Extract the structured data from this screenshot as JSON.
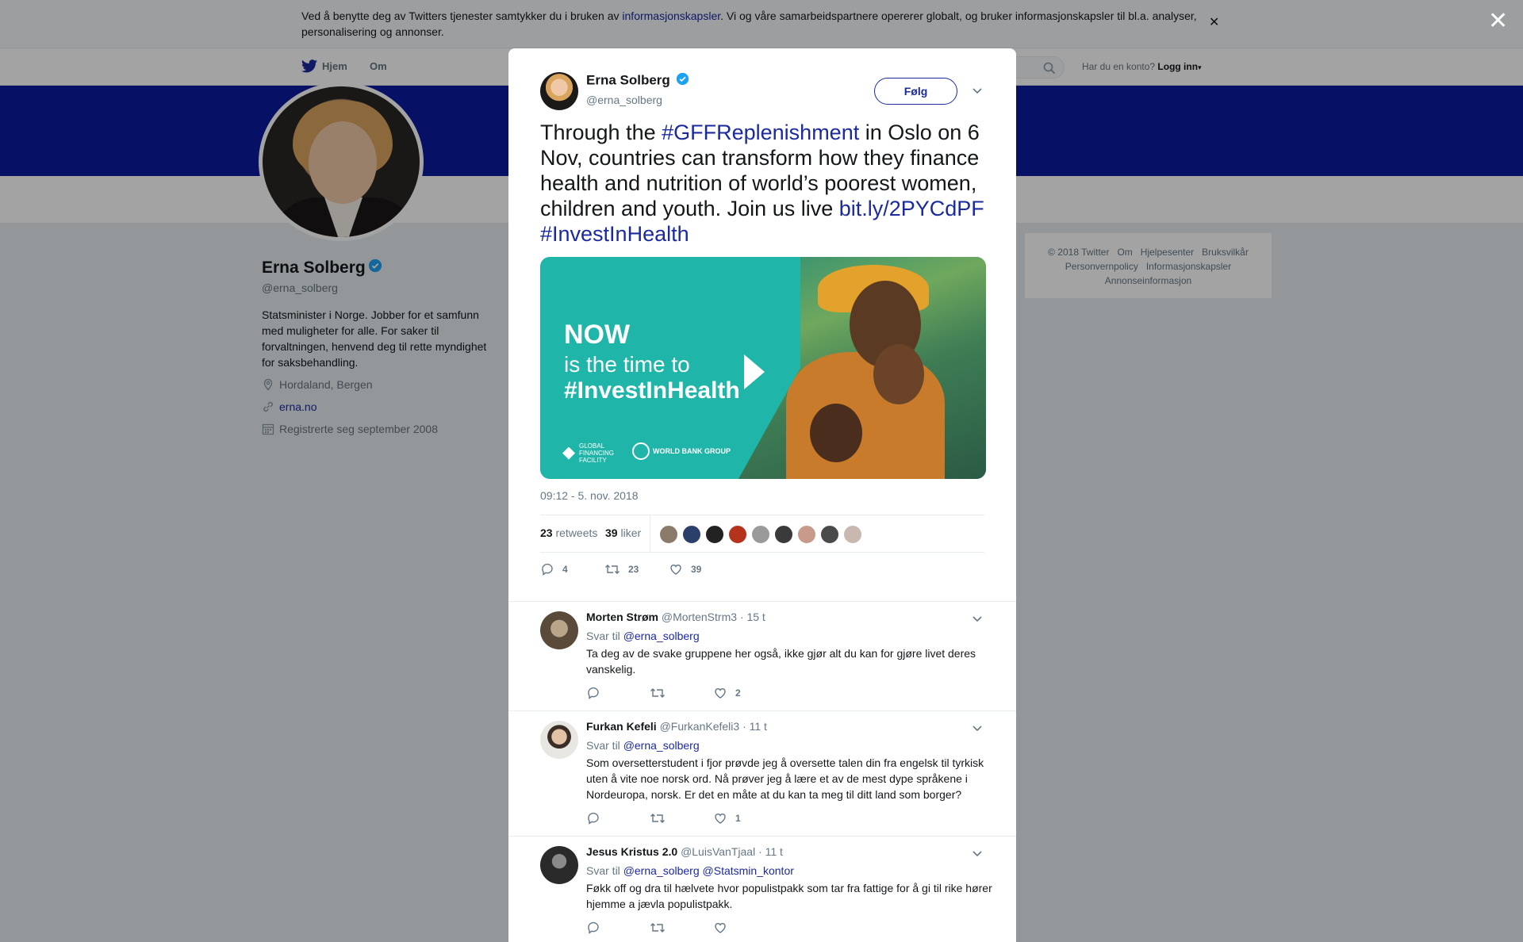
{
  "cookie": {
    "text_before": "Ved å benytte deg av Twitters tjenester samtykker du i bruken av ",
    "link": "informasjonskapsler",
    "text_after": ". Vi og våre samarbeidspartnere opererer globalt, og bruker informasjonskapsler til bl.a. analyser, personalisering og annonser."
  },
  "nav": {
    "home": "Hjem",
    "about": "Om",
    "account_prompt": "Har du en konto?",
    "login": "Logg inn"
  },
  "profile": {
    "name": "Erna Solberg",
    "handle": "@erna_solberg",
    "bio": "Statsminister i Norge. Jobber for et samfunn med muligheter for alle. For saker til forvaltningen, henvend deg til rette myndighet for saksbehandling.",
    "location": "Hordaland, Bergen",
    "website": "erna.no",
    "joined": "Registrerte seg september 2008"
  },
  "footer": {
    "copyright": "© 2018 Twitter",
    "about": "Om",
    "help": "Hjelpesenter",
    "terms": "Bruksvilkår",
    "privacy": "Personvernpolicy",
    "cookies": "Informasjonskapsler",
    "ads": "Annonseinformasjon"
  },
  "tweet": {
    "author_name": "Erna Solberg",
    "author_handle": "@erna_solberg",
    "follow_label": "Følg",
    "text_1": "Through the ",
    "hashtag_1": "#GFFReplenishment",
    "text_2": " in Oslo on 6 Nov, countries can transform how they finance health and nutrition of world’s poorest women, children and youth. Join us live ",
    "link": "bit.ly/2PYCdPF",
    "hashtag_2": "#InvestInHealth",
    "media": {
      "line_1": "NOW",
      "line_2": "is the time to",
      "line_3": "#InvestInHealth",
      "logo_1": "GLOBAL FINANCING FACILITY",
      "logo_2": "WORLD BANK GROUP"
    },
    "timestamp": "09:12 - 5. nov. 2018",
    "retweets": "23",
    "retweets_label": "retweets",
    "likes": "39",
    "likes_label": "liker",
    "reply_count": "4",
    "retweet_count": "23",
    "like_count": "39"
  },
  "replies": [
    {
      "name": "Morten Strøm",
      "handle": "@MortenStrm3",
      "time": "· 15 t",
      "reply_to_label": "Svar til",
      "reply_to": "@erna_solberg",
      "reply_to_2": "",
      "text": "Ta deg av de svake gruppene her også, ikke gjør alt du kan for gjøre livet deres vanskelig.",
      "likes": "2"
    },
    {
      "name": "Furkan Kefeli",
      "handle": "@FurkanKefeli3",
      "time": "· 11 t",
      "reply_to_label": "Svar til",
      "reply_to": "@erna_solberg",
      "reply_to_2": "",
      "text": "Som oversetterstudent i fjor prøvde jeg å oversette talen din fra engelsk til tyrkisk uten å vite noe norsk ord. Nå prøver jeg å lære et av de mest dype språkene i Nordeuropa, norsk. Er det en måte at du kan ta meg til ditt land som borger?",
      "likes": "1"
    },
    {
      "name": "Jesus Kristus 2.0",
      "handle": "@LuisVanTjaal",
      "time": "· 11 t",
      "reply_to_label": "Svar til",
      "reply_to": "@erna_solberg",
      "reply_to_2": "@Statsmin_kontor",
      "text": "Føkk off og dra til hælvete hvor populistpakk som tar fra fattige for å gi til rike hører hjemme a jævla populistpakk.",
      "likes": ""
    }
  ],
  "colors": {
    "accent": "#1b2a9e",
    "banner": "#0a1a9e",
    "media_bg": "#1fb5a8"
  }
}
